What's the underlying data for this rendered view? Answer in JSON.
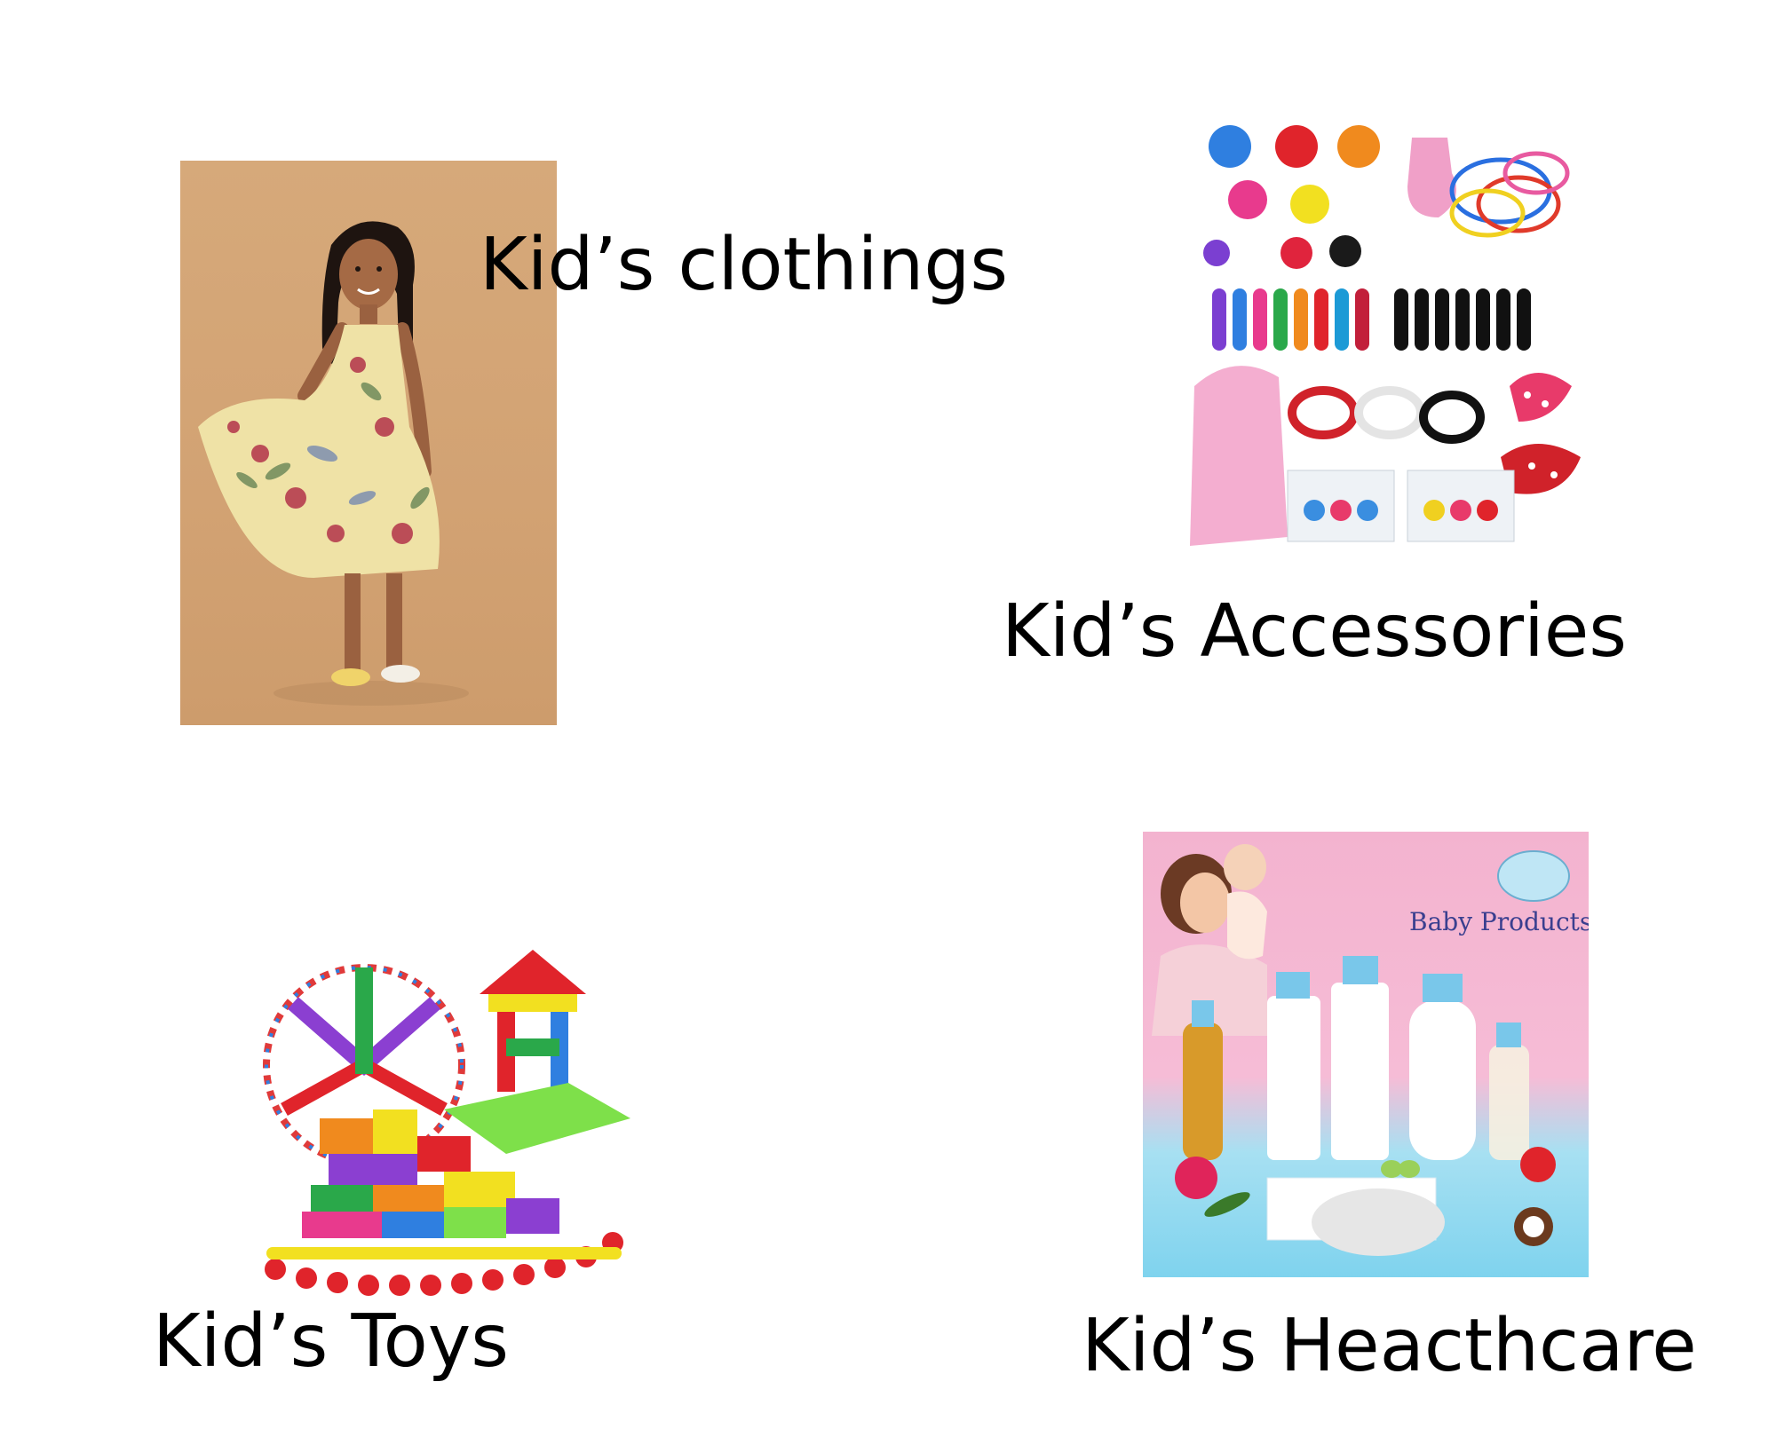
{
  "categories": {
    "clothing": {
      "label": "Kid’s clothings"
    },
    "accessories": {
      "label": "Kid’s Accessories"
    },
    "toys": {
      "label": "Kid’s Toys"
    },
    "healthcare": {
      "label": "Kid’s Heacthcare",
      "banner_text": "Baby Products"
    }
  }
}
